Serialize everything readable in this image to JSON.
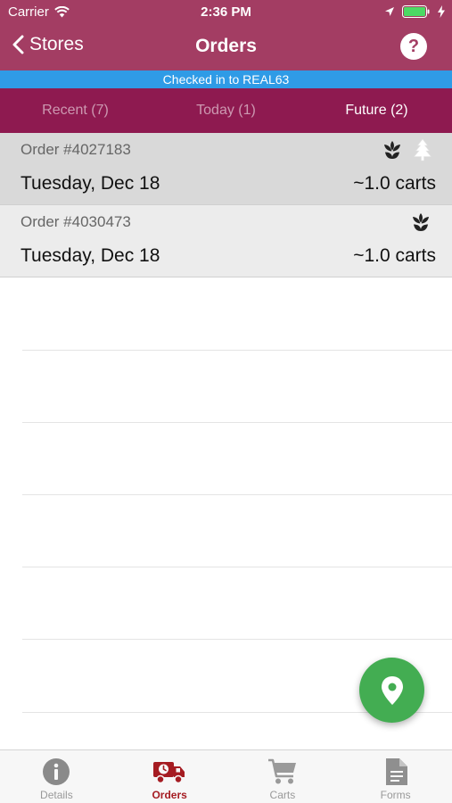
{
  "status_bar": {
    "carrier": "Carrier",
    "time": "2:36 PM"
  },
  "nav": {
    "back_label": "Stores",
    "title": "Orders",
    "help_label": "?"
  },
  "checkin_banner": "Checked in to REAL63",
  "tabs": [
    {
      "label": "Recent (7)",
      "active": false
    },
    {
      "label": "Today (1)",
      "active": false
    },
    {
      "label": "Future (2)",
      "active": true
    }
  ],
  "orders": [
    {
      "number": "Order #4027183",
      "date": "Tuesday, Dec 18",
      "carts": "~1.0 carts",
      "icons": [
        "flower-icon",
        "tree-icon"
      ]
    },
    {
      "number": "Order #4030473",
      "date": "Tuesday, Dec 18",
      "carts": "~1.0 carts",
      "icons": [
        "flower-icon"
      ]
    }
  ],
  "bottom_tabs": [
    {
      "label": "Details",
      "icon": "info-icon",
      "active": false
    },
    {
      "label": "Orders",
      "icon": "delivery-truck-icon",
      "active": true
    },
    {
      "label": "Carts",
      "icon": "cart-icon",
      "active": false
    },
    {
      "label": "Forms",
      "icon": "document-icon",
      "active": false
    }
  ],
  "colors": {
    "header": "#a33d63",
    "tabs_bg": "#8e1a50",
    "banner": "#2f9be6",
    "fab": "#43ad52",
    "active_tab_icon": "#a51c22"
  }
}
